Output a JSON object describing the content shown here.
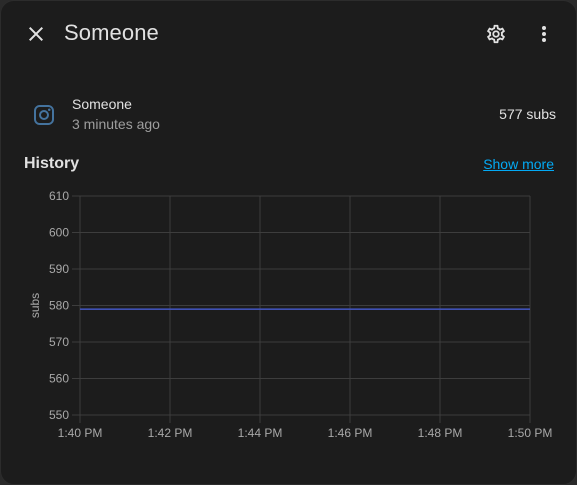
{
  "header": {
    "title": "Someone",
    "close_icon": "close-icon",
    "settings_icon": "gear-icon",
    "menu_icon": "more-vertical-icon"
  },
  "entity": {
    "icon": "instagram-icon",
    "name": "Someone",
    "last_changed": "3 minutes ago",
    "state": "577 subs"
  },
  "history": {
    "title": "History",
    "show_more": "Show more"
  },
  "colors": {
    "background": "#1c1c1c",
    "text": "#e1e1e1",
    "secondary_text": "#9e9e9e",
    "link": "#03a9f4",
    "line": "#3f51b5",
    "icon": "#44739e"
  },
  "chart_data": {
    "type": "line",
    "x": [
      "1:40 PM",
      "1:42 PM",
      "1:44 PM",
      "1:46 PM",
      "1:48 PM",
      "1:50 PM"
    ],
    "series": [
      {
        "values": [
          579,
          579,
          579,
          579,
          579,
          579
        ]
      }
    ],
    "yticks": [
      "550",
      "560",
      "570",
      "580",
      "590",
      "600",
      "610"
    ],
    "ylabel": "subs",
    "ylim": [
      550,
      610
    ],
    "grid": true
  }
}
